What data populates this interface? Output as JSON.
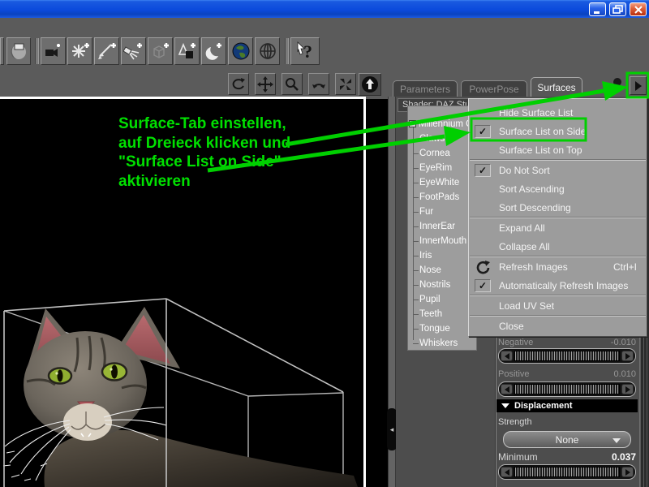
{
  "window": {
    "buttons": [
      "minimize",
      "restore-down",
      "close"
    ]
  },
  "toolbar": {
    "buttons": [
      "render-sphere",
      "new-camera",
      "new-point-light",
      "new-distant-light",
      "new-spotlight",
      "new-null",
      "new-primitive",
      "new-moon-light",
      "earth-globe",
      "wire-globe",
      "whats-this-help"
    ]
  },
  "viewport": {
    "annotation": {
      "color": "#00e000",
      "lines": [
        "Surface-Tab einstellen,",
        "auf Dreieck klicken und",
        "\"Surface List on Side\"",
        "aktivieren"
      ]
    },
    "nav_buttons": [
      "orbit",
      "pan",
      "zoom",
      "rotate",
      "frame",
      "reset-view"
    ]
  },
  "panel": {
    "tabs": [
      {
        "label": "Parameters",
        "active": false
      },
      {
        "label": "PowerPose",
        "active": false
      },
      {
        "label": "Surfaces",
        "active": true
      }
    ],
    "shader_label": "Shader: DAZ Stud",
    "surface_tree": {
      "root": "Millennium Cat L",
      "children": [
        "Claws",
        "Cornea",
        "EyeRim",
        "EyeWhite",
        "FootPads",
        "Fur",
        "InnerEar",
        "InnerMouth",
        "Iris",
        "Nose",
        "Nostrils",
        "Pupil",
        "Teeth",
        "Tongue",
        "Whiskers"
      ]
    },
    "menu": {
      "items": [
        {
          "label": "Hide Surface List",
          "checked": false
        },
        {
          "label": "Surface List on Side",
          "checked": true,
          "highlighted": true
        },
        {
          "label": "Surface List on Top",
          "checked": false
        },
        {
          "label": "Do Not Sort",
          "checked": true
        },
        {
          "label": "Sort Ascending",
          "checked": false
        },
        {
          "label": "Sort Descending",
          "checked": false
        },
        {
          "label": "Expand All",
          "checked": false
        },
        {
          "label": "Collapse All",
          "checked": false
        },
        {
          "label": "Refresh Images",
          "checked": false,
          "icon": "refresh-icon",
          "shortcut": "Ctrl+I"
        },
        {
          "label": "Automatically Refresh Images",
          "checked": true
        },
        {
          "label": "Load UV Set",
          "checked": false
        },
        {
          "label": "Close",
          "checked": false
        }
      ],
      "check_glyph": "✓"
    },
    "properties": {
      "negative": {
        "label": "Negative",
        "value": "-0.010",
        "disabled": true
      },
      "positive": {
        "label": "Positive",
        "value": "0.010",
        "disabled": true
      },
      "displacement": {
        "label": "Displacement"
      },
      "strength": {
        "label": "Strength",
        "value": "None"
      },
      "minimum": {
        "label": "Minimum",
        "value": "0.037"
      }
    }
  }
}
